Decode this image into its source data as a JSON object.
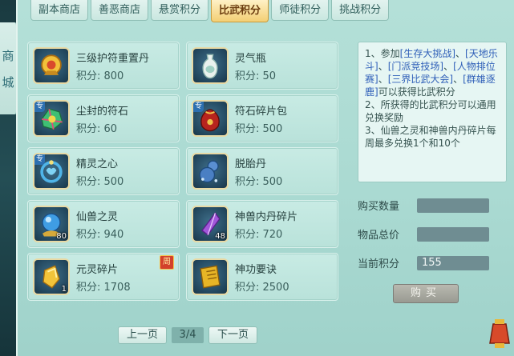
{
  "side_tab": {
    "chars": [
      "商",
      "城"
    ]
  },
  "tabs": [
    {
      "label": "副本商店"
    },
    {
      "label": "善恶商店"
    },
    {
      "label": "悬赏积分"
    },
    {
      "label": "比武积分",
      "active": true
    },
    {
      "label": "师徒积分"
    },
    {
      "label": "挑战积分"
    }
  ],
  "items": [
    {
      "name": "三级护符重置丹",
      "price": "积分: 800",
      "icon": "golden-talisman-icon"
    },
    {
      "name": "灵气瓶",
      "price": "积分: 50",
      "icon": "vase-icon"
    },
    {
      "name": "尘封的符石",
      "price": "积分: 60",
      "tag": "专",
      "icon": "runestone-icon"
    },
    {
      "name": "符石碎片包",
      "price": "积分: 500",
      "tag": "专",
      "icon": "red-pouch-icon"
    },
    {
      "name": "精灵之心",
      "price": "积分: 500",
      "tag": "专",
      "icon": "spirit-heart-icon"
    },
    {
      "name": "脱胎丹",
      "price": "积分: 500",
      "icon": "gourd-icon"
    },
    {
      "name": "仙兽之灵",
      "price": "积分: 940",
      "count": "80",
      "icon": "blue-orb-icon"
    },
    {
      "name": "神兽内丹碎片",
      "price": "积分: 720",
      "count": "48",
      "icon": "purple-crystal-icon"
    },
    {
      "name": "元灵碎片",
      "price": "积分: 1708",
      "count": "1",
      "badge": "周",
      "icon": "gold-shard-icon"
    },
    {
      "name": "神功要诀",
      "price": "积分: 2500",
      "icon": "golden-book-icon"
    }
  ],
  "pager": {
    "prev": "上一页",
    "page": "3/4",
    "next": "下一页"
  },
  "description": {
    "l1_a": "1、参加",
    "l1_h1": "[生存大挑战]",
    "l1_b": "、",
    "l1_h2": "[天地乐斗]",
    "l1_c": "、",
    "l1_h3": "[门派竞技场]",
    "l1_d": "、",
    "l1_h4": "[人物排位赛]",
    "l1_e": "、",
    "l1_h5": "[三界比武大会]",
    "l1_f": "、",
    "l1_h6": "[群雄逐鹿]",
    "l1_g": "可以获得比武积分",
    "l2": "2、所获得的比武积分可以通用兑换奖励",
    "l3": "3、仙兽之灵和神兽内丹碎片每周最多兑换1个和10个"
  },
  "form": {
    "qty_label": "购买数量",
    "qty_value": "",
    "total_label": "物品总价",
    "total_value": "",
    "points_label": "当前积分",
    "points_value": "155"
  },
  "buy_label": "购买",
  "colors": {
    "highlight": "#2f5fb8",
    "active_tab": "#f3cf74",
    "panel": "#b4e0d8"
  }
}
